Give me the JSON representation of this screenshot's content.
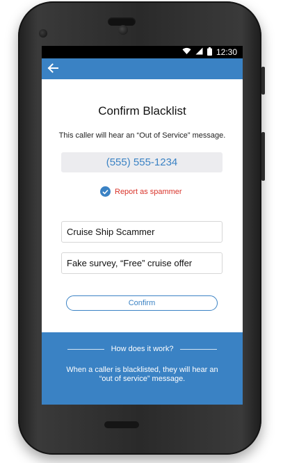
{
  "status_bar": {
    "time": "12:30",
    "wifi_icon": "wifi-icon",
    "signal_icon": "signal-icon",
    "battery_icon": "battery-icon"
  },
  "app_bar": {
    "back_icon": "back-arrow-icon",
    "color": "#3a82c4"
  },
  "main": {
    "title": "Confirm Blacklist",
    "subtitle": "This caller will hear an “Out of Service” message.",
    "phone_number": "(555) 555-1234",
    "report_spam_label": "Report as spammer",
    "report_spam_checked": true,
    "name_field_value": "Cruise Ship Scammer",
    "note_field_value": "Fake survey, “Free” cruise offer",
    "confirm_label": "Confirm"
  },
  "info": {
    "heading": "How does it work?",
    "body": "When a caller is blacklisted, they will hear an “out of service” message."
  },
  "colors": {
    "accent": "#3a82c4",
    "spam_red": "#d9342b"
  }
}
